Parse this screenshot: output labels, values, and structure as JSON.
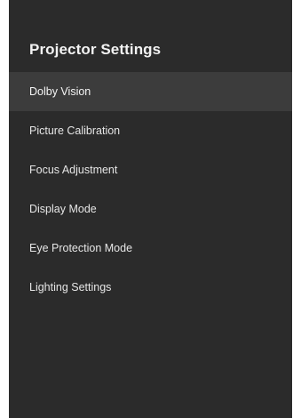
{
  "header": {
    "title": "Projector Settings"
  },
  "menu": {
    "selected_index": 0,
    "items": [
      {
        "label": "Dolby Vision"
      },
      {
        "label": "Picture Calibration"
      },
      {
        "label": "Focus Adjustment"
      },
      {
        "label": "Display Mode"
      },
      {
        "label": "Eye Protection Mode"
      },
      {
        "label": "Lighting Settings"
      }
    ]
  },
  "colors": {
    "panel_background": "#2b2b2b",
    "selected_row": "#3c3c3c",
    "text": "#e6e6e6"
  }
}
